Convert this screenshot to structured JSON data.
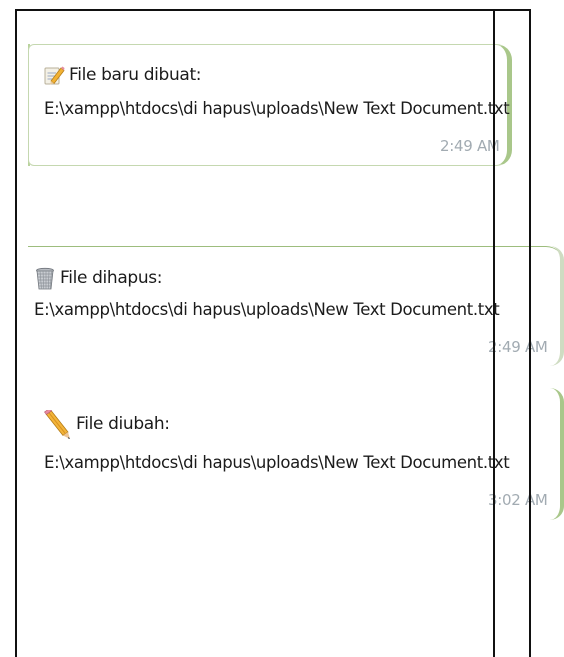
{
  "messages": [
    {
      "icon": "memo-pencil-icon",
      "title": "File baru dibuat:",
      "path": "E:\\xampp\\htdocs\\di hapus\\uploads\\New Text Document.txt",
      "time": "2:49 AM"
    },
    {
      "icon": "wastebasket-icon",
      "title": "File dihapus:",
      "path": "E:\\xampp\\htdocs\\di hapus\\uploads\\New Text Document.txt",
      "time": "2:49 AM"
    },
    {
      "icon": "pencil-icon",
      "title": "File diubah:",
      "path": "E:\\xampp\\htdocs\\di hapus\\uploads\\New Text Document.txt",
      "time": "3:02 AM"
    }
  ],
  "colors": {
    "bubble_accent": "#a9c78a",
    "time_text": "#a2abb2",
    "message_text": "#1b1b1b"
  }
}
